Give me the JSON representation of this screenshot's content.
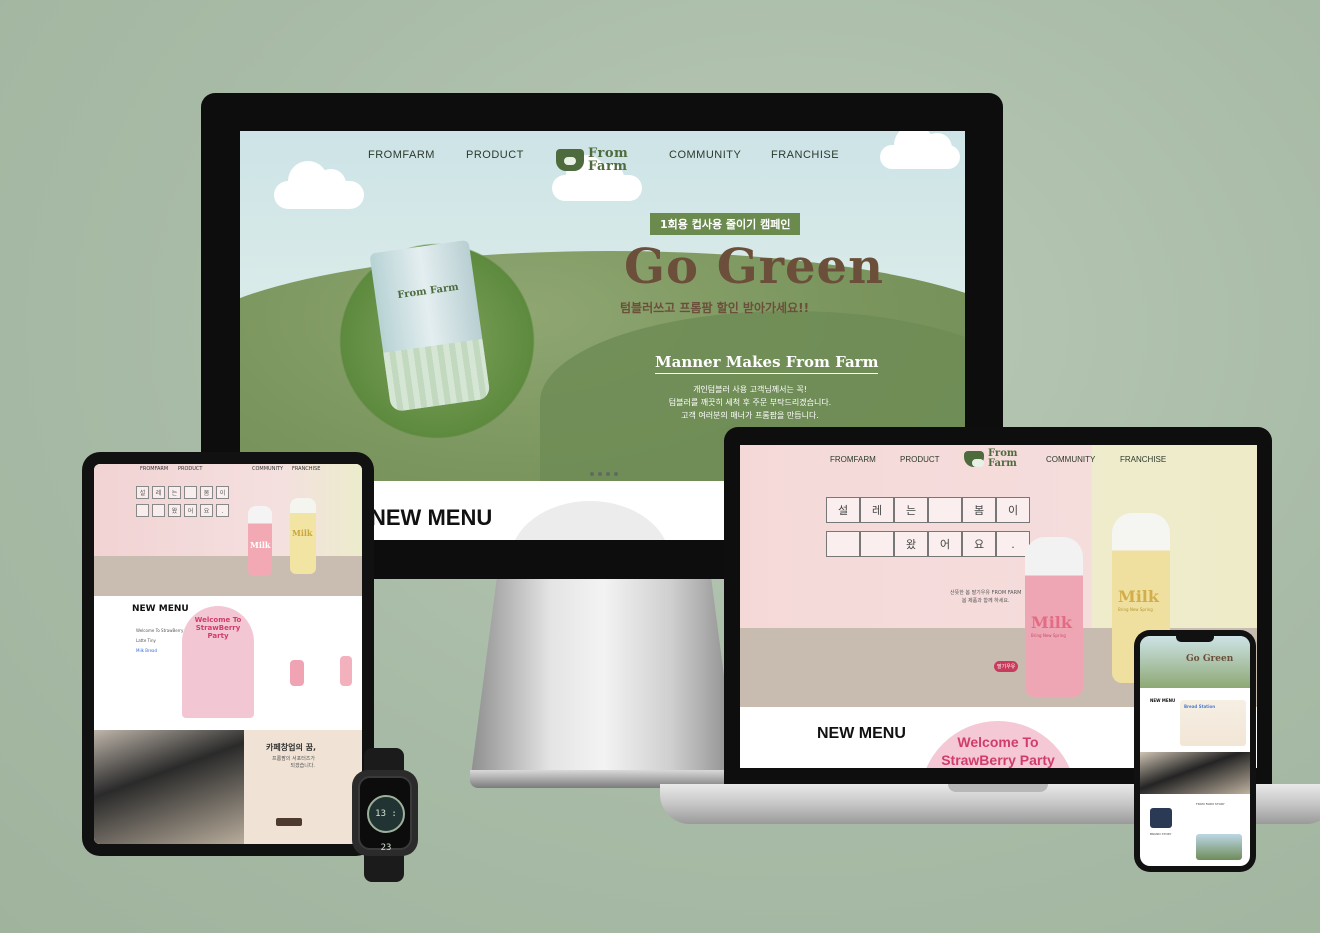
{
  "desktop": {
    "nav": {
      "item1": "FROMFARM",
      "item2": "PRODUCT",
      "item3": "COMMUNITY",
      "item4": "FRANCHISE"
    },
    "logo": {
      "line1": "From",
      "line2": "Farm"
    },
    "hero": {
      "badge": "1회용 컵사용 줄이기 캠페인",
      "title": "Go Green",
      "subtitle": "텀블러쓰고 프롬팜 할인 받아가세요!!",
      "cup_logo": "From Farm",
      "slogan": "Manner Makes From Farm",
      "desc1": "개인텀블러 사용 고객님께서는 꼭!",
      "desc2": "텀블러를 깨끗히 세척 후 주문 부탁드리겠습니다.",
      "desc3": "고객 여러분의 매너가 프롬팜을 만듭니다."
    },
    "section_title": "NEW MENU"
  },
  "tablet": {
    "nav": {
      "item1": "FROMFARM",
      "item2": "PRODUCT",
      "item3": "COMMUNITY",
      "item4": "FRANCHISE"
    },
    "grid_row1": [
      "설",
      "레",
      "는",
      "",
      "봄",
      "이"
    ],
    "grid_row2": [
      "",
      "",
      "왔",
      "어",
      "요",
      "."
    ],
    "milk": "Milk",
    "section_title": "NEW MENU",
    "welcome": "Welcome To StrawBerry Party",
    "menu_list": [
      "Welcome To StrawBerry",
      "Latte Tiny",
      "Milk Bread"
    ],
    "cafe_title": "카페창업의 꿈,",
    "cafe_sub1": "프롬팜의 서포터즈가",
    "cafe_sub2": "되겠습니다."
  },
  "watch": {
    "time": "13 : 23"
  },
  "laptop": {
    "nav": {
      "item1": "FROMFARM",
      "item2": "PRODUCT",
      "item3": "COMMUNITY",
      "item4": "FRANCHISE"
    },
    "logo": {
      "line1": "From",
      "line2": "Farm"
    },
    "grid_row1": [
      "설",
      "레",
      "는",
      "",
      "봄",
      "이"
    ],
    "grid_row2": [
      "",
      "",
      "왔",
      "어",
      "요",
      "."
    ],
    "sub1": "산뜻한 봄 딸기우유 FROM FARM",
    "sub2": "봄 제품과 함께 하세요.",
    "milk": "Milk",
    "milk_tag": "Bring New Spring",
    "badge": "딸기우유",
    "section_title": "NEW MENU",
    "welcome1": "Welcome To",
    "welcome2": "StrawBerry Party"
  },
  "phone": {
    "title": "Go Green",
    "section_title": "NEW MENU",
    "bread": "Bread Station",
    "brand": "BRAND STORY",
    "farm": "FROM FARM STORY"
  },
  "colors": {
    "brand_green": "#4e6b3e",
    "brown_title": "#6b4f3a",
    "pink_accent": "#d13d6a",
    "background": "#a9bca8"
  }
}
